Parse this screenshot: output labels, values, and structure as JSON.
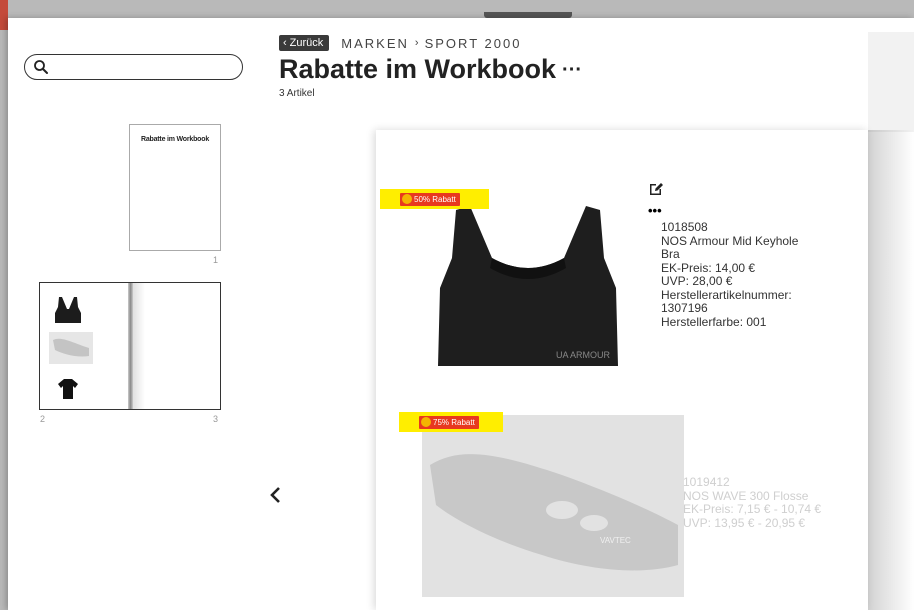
{
  "search": {
    "placeholder": ""
  },
  "breadcrumb": {
    "back_label": "Zurück",
    "items": [
      "MARKEN",
      "SPORT 2000"
    ]
  },
  "page": {
    "title": "Rabatte im Workbook",
    "more_label": "···",
    "count": "3 Artikel"
  },
  "thumbnails": {
    "cover_title": "Rabatte im Workbook",
    "page_numbers": [
      "1",
      "2",
      "3"
    ]
  },
  "products": [
    {
      "badge": "50% Rabatt",
      "lines": [
        "1018508",
        "NOS Armour Mid Keyhole",
        "Bra",
        "EK-Preis: 14,00 €",
        "UVP: 28,00 €",
        "Herstellerartikelnummer:",
        "1307196",
        "Herstellerfarbe: 001"
      ],
      "brand_print": "UA ARMOUR"
    },
    {
      "badge": "75% Rabatt",
      "lines": [
        "1019412",
        "NOS WAVE 300 Flosse",
        "EK-Preis: 7,15 € - 10,74 €",
        "UVP: 13,95 € - 20,95 €"
      ],
      "brand_print": "VAVTEC"
    }
  ],
  "colors": {
    "badge_red": "#e8381f",
    "badge_highlight": "#ffee00",
    "title": "#222222"
  },
  "icons": [
    "search-icon",
    "chevron-left-icon",
    "edit-icon",
    "more-icon",
    "sun-icon"
  ]
}
